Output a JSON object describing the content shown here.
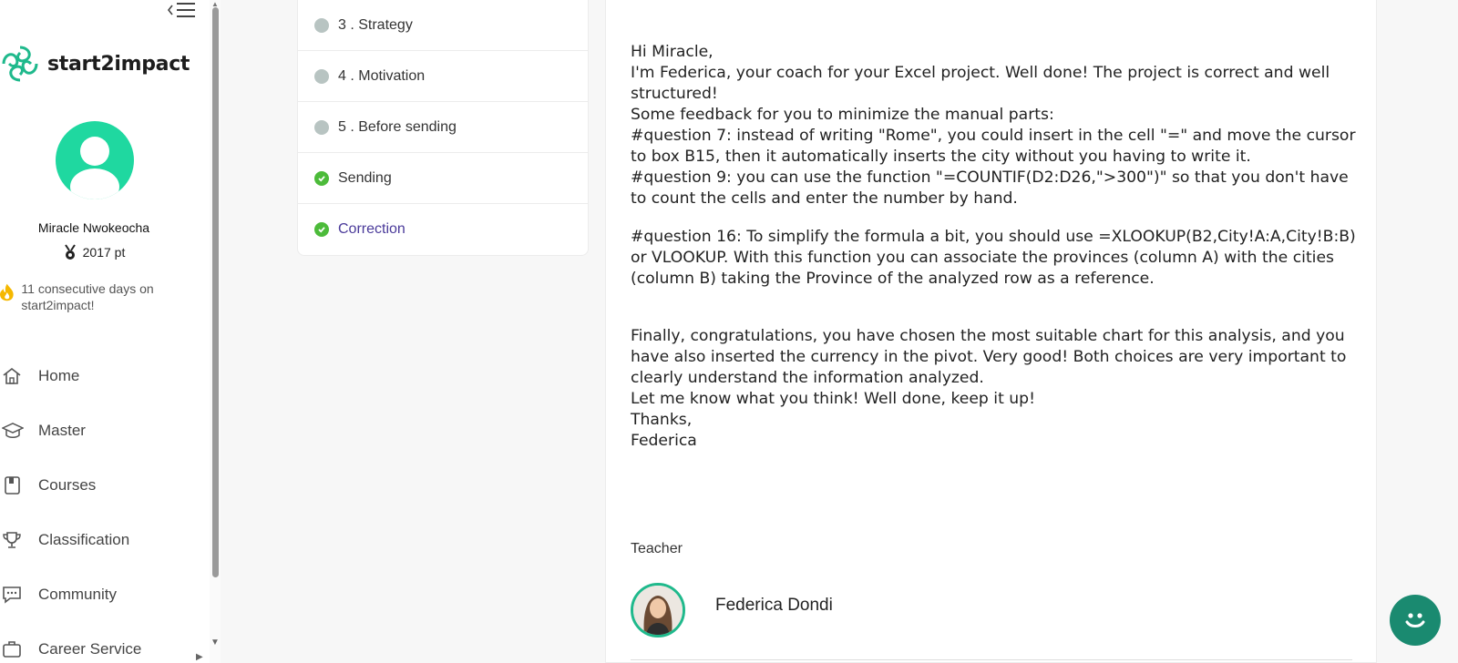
{
  "brand": {
    "name": "start2impact"
  },
  "user": {
    "name": "Miracle Nwokeocha",
    "points": "2017 pt",
    "streak": "11 consecutive days on start2impact!"
  },
  "nav": {
    "items": [
      {
        "label": "Home",
        "icon": "home-icon"
      },
      {
        "label": "Master",
        "icon": "graduation-cap-icon"
      },
      {
        "label": "Courses",
        "icon": "book-icon"
      },
      {
        "label": "Classification",
        "icon": "trophy-icon"
      },
      {
        "label": "Community",
        "icon": "chat-icon"
      },
      {
        "label": "Career Service",
        "icon": "briefcase-icon"
      }
    ]
  },
  "steps": [
    {
      "label": "3 .  Strategy",
      "status": "pending"
    },
    {
      "label": "4 .  Motivation",
      "status": "pending"
    },
    {
      "label": "5 .  Before sending",
      "status": "pending"
    },
    {
      "label": "Sending",
      "status": "done"
    },
    {
      "label": "Correction",
      "status": "done-active"
    }
  ],
  "feedback": {
    "greeting": "Hi Miracle,",
    "p1": "I'm Federica, your coach for your Excel project. Well done! The project is correct and well structured!",
    "p2": "Some feedback for you to minimize the manual parts:",
    "q7": "#question 7: instead of writing \"Rome\", you could insert in the cell \"=\" and move the cursor to box B15, then it automatically inserts the city without you having to write it.",
    "q9": "#question 9: you can use the function \"=COUNTIF(D2:D26,\">300\")\" so that you don't have to count the cells and enter the number by hand.",
    "q16": "#question 16: To simplify the formula a bit, you should use =XLOOKUP(B2,City!A:A,City!B:B) or VLOOKUP. With this function you can associate the provinces (column A) with the cities (column B) taking the Province of the analyzed row as a reference.",
    "p3": "Finally, congratulations, you have chosen the most suitable chart for this analysis, and you have also inserted the currency in the pivot. Very good! Both choices are very important to clearly understand the information analyzed.",
    "p4": "Let me know what you think! Well done, keep it up!",
    "thanks": "Thanks,",
    "signature": "Federica"
  },
  "teacher": {
    "label": "Teacher",
    "name": "Federica Dondi"
  },
  "colors": {
    "brand_green": "#1fd8a0",
    "accent_purple": "#4a3a9a",
    "done_green": "#4cbb3a",
    "chat_bg": "#1a8a70"
  }
}
